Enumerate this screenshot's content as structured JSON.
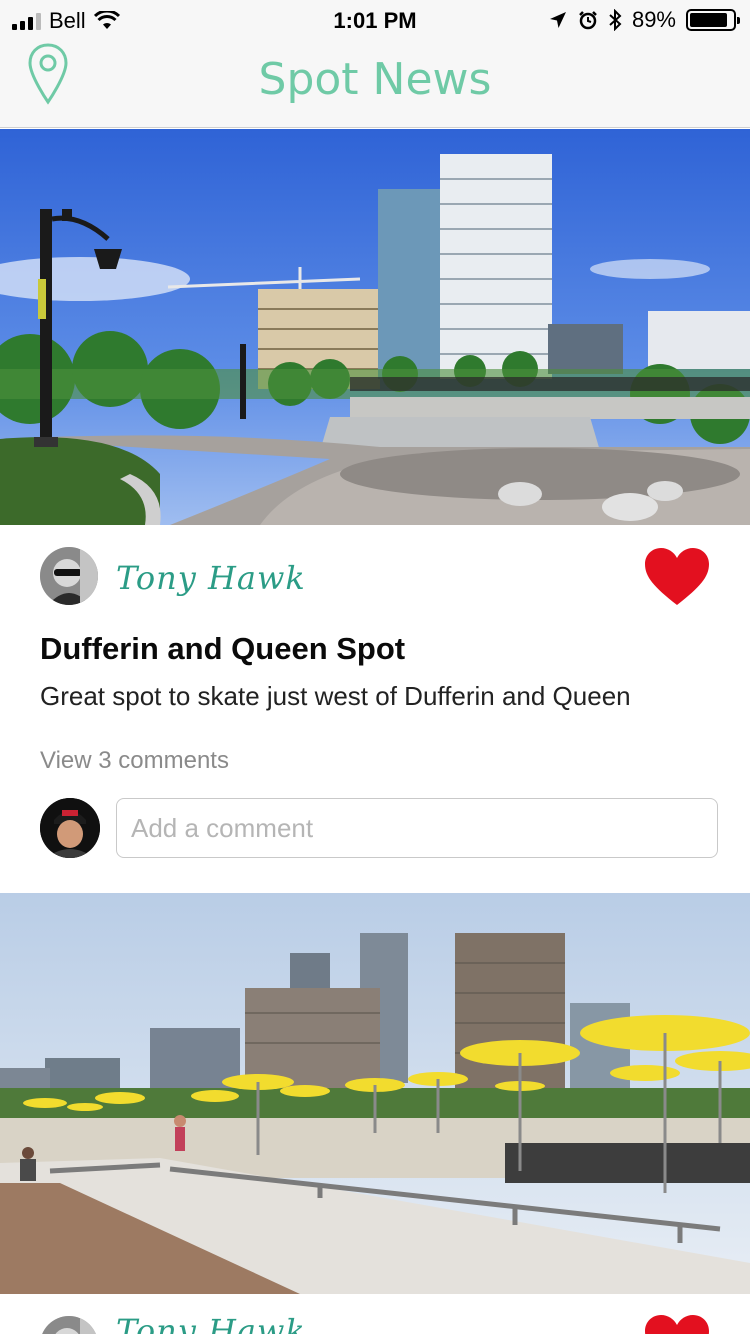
{
  "status_bar": {
    "carrier": "Bell",
    "time": "1:01 PM",
    "battery_percent": "89%",
    "battery_level": 0.89
  },
  "nav": {
    "title": "Spot News",
    "left_icon": "map-pin-icon",
    "accent_color": "#6fcaa6"
  },
  "posts": [
    {
      "author": "Tony Hawk",
      "title": "Dufferin and Queen Spot",
      "description": "Great spot to skate just west of Dufferin and Queen",
      "view_comments": "View 3 comments",
      "comment_placeholder": "Add a comment",
      "liked": true,
      "like_color": "#e3101f"
    },
    {
      "author": "Tony Hawk",
      "liked": true
    }
  ]
}
